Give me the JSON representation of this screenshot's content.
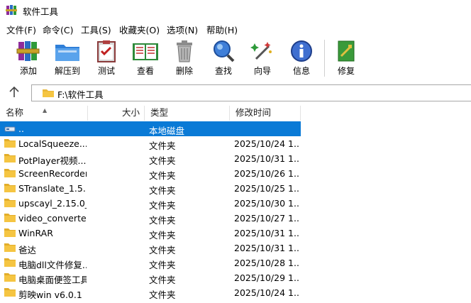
{
  "window": {
    "title": "软件工具",
    "icon": "winrar-books-icon"
  },
  "menu": [
    "文件(F)",
    "命令(C)",
    "工具(S)",
    "收藏夹(O)",
    "选项(N)",
    "帮助(H)"
  ],
  "toolbar": [
    {
      "label": "添加",
      "icon": "add-archive-icon"
    },
    {
      "label": "解压到",
      "icon": "extract-folder-icon"
    },
    {
      "label": "测试",
      "icon": "test-clipboard-icon"
    },
    {
      "label": "查看",
      "icon": "view-book-icon"
    },
    {
      "label": "删除",
      "icon": "trash-icon"
    },
    {
      "label": "查找",
      "icon": "magnifier-icon"
    },
    {
      "label": "向导",
      "icon": "wizard-wand-icon"
    },
    {
      "label": "信息",
      "icon": "info-icon"
    },
    {
      "label": "修复",
      "icon": "repair-icon"
    }
  ],
  "address": {
    "path": "F:\\软件工具",
    "up_icon": "arrow-up-icon"
  },
  "columns": {
    "name": "名称",
    "size": "大小",
    "type": "类型",
    "modified": "修改时间"
  },
  "rows": [
    {
      "name": "..",
      "type": "本地磁盘",
      "modified": "",
      "icon": "drive-icon",
      "selected": true
    },
    {
      "name": "LocalSqueeze...",
      "type": "文件夹",
      "modified": "2025/10/24 1...",
      "icon": "folder-icon"
    },
    {
      "name": "PotPlayer视频...",
      "type": "文件夹",
      "modified": "2025/10/31 1...",
      "icon": "folder-icon"
    },
    {
      "name": "ScreenRecorder",
      "type": "文件夹",
      "modified": "2025/10/26 1...",
      "icon": "folder-icon"
    },
    {
      "name": "STranslate_1.5....",
      "type": "文件夹",
      "modified": "2025/10/25 1...",
      "icon": "folder-icon"
    },
    {
      "name": "upscayl_2.15.0_...",
      "type": "文件夹",
      "modified": "2025/10/30 1...",
      "icon": "folder-icon"
    },
    {
      "name": "video_converte...",
      "type": "文件夹",
      "modified": "2025/10/27 1...",
      "icon": "folder-icon"
    },
    {
      "name": "WinRAR",
      "type": "文件夹",
      "modified": "2025/10/31 1...",
      "icon": "folder-icon"
    },
    {
      "name": "爸达",
      "type": "文件夹",
      "modified": "2025/10/31 1...",
      "icon": "folder-icon"
    },
    {
      "name": "电脑dll文件修复...",
      "type": "文件夹",
      "modified": "2025/10/28 1...",
      "icon": "folder-icon"
    },
    {
      "name": "电脑桌面便签工具",
      "type": "文件夹",
      "modified": "2025/10/29 1...",
      "icon": "folder-icon"
    },
    {
      "name": "剪映win v6.0.1",
      "type": "文件夹",
      "modified": "2025/10/24 1...",
      "icon": "folder-icon"
    }
  ],
  "colors": {
    "selection": "#0a7ad6",
    "folder": "#f5c542"
  }
}
